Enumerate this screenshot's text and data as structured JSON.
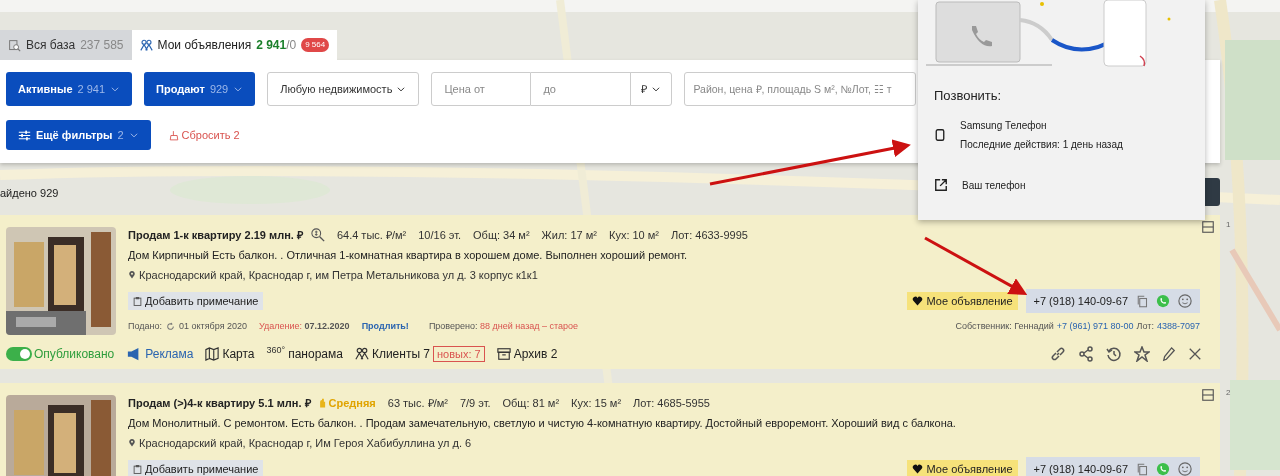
{
  "tabs": [
    {
      "label": "Вся база",
      "count": "237 585",
      "selected": false
    },
    {
      "label": "Мои объявления",
      "count": "2 941",
      "suffix": "/0",
      "badge": "9 564",
      "selected": true
    }
  ],
  "filters": {
    "status": {
      "label": "Активные",
      "count": "2 941"
    },
    "deal": {
      "label": "Продают",
      "count": "929"
    },
    "property": {
      "label": "Любую недвижимость"
    },
    "price": {
      "from_placeholder": "Цена от",
      "to_placeholder": "до",
      "currency": "₽"
    },
    "search": {
      "placeholder": "Район, цена ₽, площадь S м², №Лот, ☷ т"
    },
    "more": {
      "label": "Ещё фильтры",
      "count": "2"
    },
    "reset": {
      "label": "Сбросить 2"
    }
  },
  "found": "айдено 929",
  "call_popup": {
    "title": "Позвонить:",
    "devices": [
      {
        "kind": "phone",
        "name": "Samsung Телефон",
        "detail": "Последние действия: 1 день назад"
      },
      {
        "kind": "link",
        "name": "Ваш телефон"
      }
    ]
  },
  "listings": [
    {
      "number": "1",
      "title": "Продам 1-к квартиру 2.19 млн. ₽",
      "assessment": {
        "kind": "search"
      },
      "price_per_m": "64.4 тыс. ₽/м²",
      "specs": [
        "10/16 эт.",
        "Общ: 34 м²",
        "Жил: 17 м²",
        "Кух: 10 м²",
        "Лот: 4633-9995"
      ],
      "description": "Дом Кирпичный Есть балкон. . Отличная 1-комнатная квартира в хорошем доме. Выполнен хороший ремонт.",
      "address": "Краснодарский край, Краснодар г, им Петра Метальникова ул д. 3 корпус к1к1",
      "note_button": "Добавить примечание",
      "mine_label": "Мое объявление",
      "phone": "+7 (918) 140-09-67",
      "posted": {
        "label": "Подано:",
        "date": "01 октября 2020"
      },
      "removal": {
        "label": "Удаление:",
        "date": "07.12.2020"
      },
      "extend": "Продлить!",
      "checked": {
        "label": "Проверено:",
        "value": "88 дней назад – старое"
      },
      "owner": {
        "label": "Собственник: Геннадий",
        "phone": "+7 (961) 971 80-00",
        "lot_label": "Лот:",
        "lot": "4388-7097"
      },
      "published": {
        "label": "Опубликовано",
        "on": true
      },
      "actions": [
        {
          "kind": "ad",
          "label": "Реклама"
        },
        {
          "kind": "map",
          "label": "Карта"
        },
        {
          "kind": "panorama",
          "icon_text": "360°",
          "label": "панорама"
        },
        {
          "kind": "clients",
          "label": "Клиенты 7",
          "badge": "новых: 7"
        },
        {
          "kind": "archive",
          "label": "Архив 2"
        }
      ]
    },
    {
      "number": "2",
      "title": "Продам (>)4-к квартиру 5.1 млн. ₽",
      "assessment": {
        "kind": "average",
        "label": "Средняя"
      },
      "price_per_m": "63 тыс. ₽/м²",
      "specs": [
        "7/9 эт.",
        "Общ: 81 м²",
        "Кух: 15 м²",
        "Лот: 4685-5955"
      ],
      "description": "Дом Монолитный. С ремонтом. Есть балкон. . Продам замечательную, светлую и чистую 4-комнатную квартиру. Достойный евроремонт. Хороший вид с балкона.",
      "address": "Краснодарский край, Краснодар г, Им Героя Хабибуллина ул д. 6",
      "note_button": "Добавить примечание",
      "mine_label": "Мое объявление",
      "phone": "+7 (918) 140-09-67"
    }
  ]
}
